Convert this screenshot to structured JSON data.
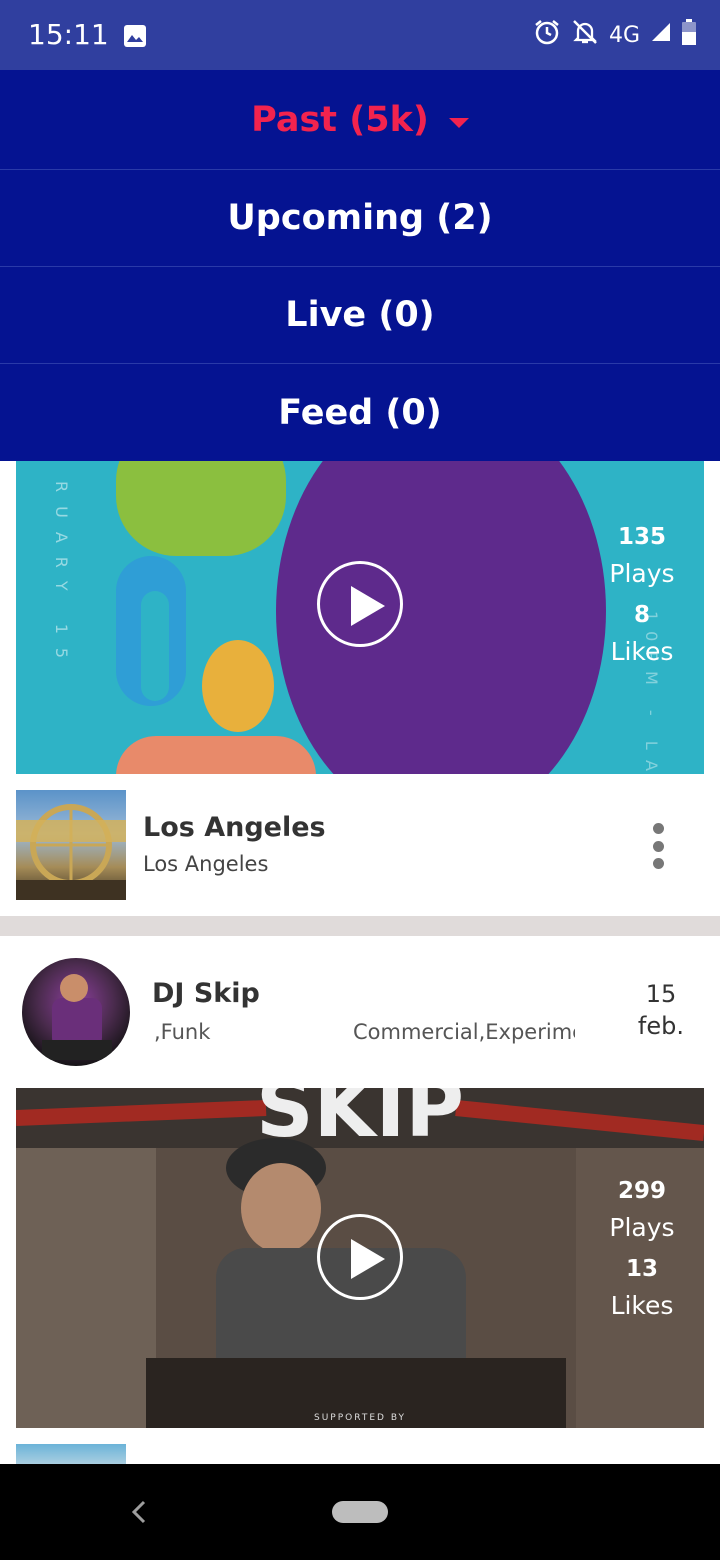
{
  "status_bar": {
    "time": "15:11",
    "network": "4G",
    "icons": [
      "image-icon",
      "alarm-icon",
      "notifications-off-icon",
      "signal-icon",
      "battery-icon"
    ]
  },
  "filter_menu": {
    "items": [
      {
        "label": "Past (5k)",
        "active": true
      },
      {
        "label": "Upcoming (2)",
        "active": false
      },
      {
        "label": "Live (0)",
        "active": false
      },
      {
        "label": "Feed (0)",
        "active": false
      }
    ]
  },
  "cards": [
    {
      "plays_count": "135",
      "plays_label": "Plays",
      "likes_count": "8",
      "likes_label": "Likes",
      "location_title": "Los Angeles",
      "location_subtitle": "Los Angeles"
    },
    {
      "dj_name": "DJ Skip",
      "genre_left": ",Funk",
      "genre_right": "Commercial,Experime",
      "date_day": "15",
      "date_month": "feb.",
      "plays_count": "299",
      "plays_label": "Plays",
      "likes_count": "13",
      "likes_label": "Likes"
    }
  ],
  "colors": {
    "status_bar_bg": "#303f9f",
    "menu_bg": "#051391",
    "active_accent": "#f2234e"
  }
}
